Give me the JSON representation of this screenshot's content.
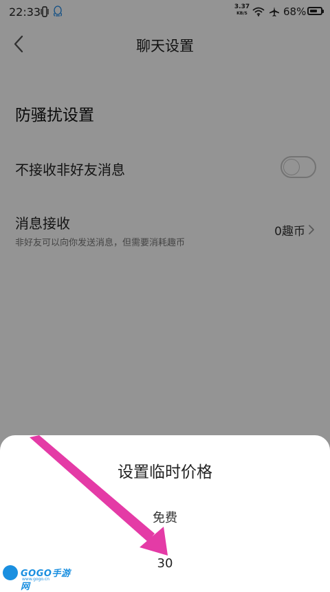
{
  "status_bar": {
    "time": "22:33",
    "net_speed_value": "3.37",
    "net_speed_unit": "KB/S",
    "battery": "68%",
    "battery_level": 0.68,
    "icons": [
      "vibrate-icon",
      "qq-icon",
      "wifi-icon",
      "airplane-icon",
      "battery-icon"
    ]
  },
  "nav": {
    "title": "聊天设置",
    "back_icon": "chevron-left-icon"
  },
  "section": {
    "title": "防骚扰设置"
  },
  "settings": {
    "strangers": {
      "label": "不接收非好友消息",
      "toggle_on": false
    },
    "receive": {
      "label": "消息接收",
      "sub": "非好友可以向你发送消息，但需要消耗趣币",
      "value": "0趣币",
      "chevron_icon": "chevron-right-icon"
    }
  },
  "sheet": {
    "title": "设置临时价格",
    "options": [
      "免费",
      "30"
    ]
  },
  "annotation": {
    "arrow_color": "#e43ba6"
  },
  "watermark": {
    "brand": "GOGO手游网",
    "domain": "www.gogo.cn"
  },
  "colors": {
    "overlay": "rgba(0,0,0,0.42)",
    "accent_pink": "#e43ba6",
    "watermark_blue": "#1a8fe0"
  }
}
